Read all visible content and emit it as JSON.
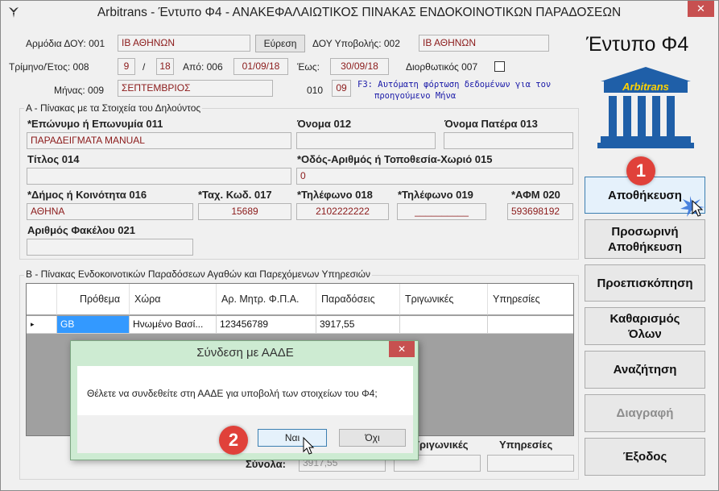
{
  "window": {
    "title": "Arbitrans - Έντυπο Φ4 - ΑΝΑΚΕΦΑΛΑΙΩΤΙΚΟΣ ΠΙΝΑΚΑΣ ΕΝΔΟΚΟΙΝΟΤΙΚΩΝ ΠΑΡΑΔΟΣΕΩΝ",
    "close_glyph": "✕"
  },
  "header": {
    "doy_label": "Αρμόδια ΔΟΥ: 001",
    "doy_value": "ΙΒ ΑΘΗΝΩΝ",
    "search_btn": "Εύρεση",
    "doy_submit_label": "ΔΟΥ Υποβολής: 002",
    "doy_submit_value": "ΙΒ ΑΘΗΝΩΝ",
    "quarter_label": "Τρίμηνο/Έτος: 008",
    "quarter_value": "9",
    "slash": "/",
    "year_value": "18",
    "from_label": "Από: 006",
    "from_value": "01/09/18",
    "to_label": "Έως:",
    "to_value": "30/09/18",
    "corrective_label": "Διορθωτικός 007",
    "month_label": "Μήνας: 009",
    "month_value": "ΣΕΠΤΕΜΒΡΙΟΣ",
    "code010_label": "010",
    "code010_value": "09",
    "hint_line1": "F3: Αυτόματη φόρτωση δεδομένων για τον",
    "hint_line2": "προηγούμενο Μήνα"
  },
  "form_title": "Έντυπο Φ4",
  "logo_text": "Arbitrans",
  "sectionA": {
    "title": "Α - Πίνακας με τα Στοιχεία του Δηλούντος",
    "name_label": "*Επώνυμο ή Επωνυμία 011",
    "name_value": "ΠΑΡΑΔΕΙΓΜΑΤΑ MANUAL",
    "first_name_label": "Όνομα 012",
    "first_name_value": "",
    "father_label": "Όνομα Πατέρα 013",
    "father_value": "",
    "title_label": "Τίτλος 014",
    "title_value": "",
    "street_label": "*Οδός-Αριθμός ή Τοποθεσία-Χωριό 015",
    "street_value": "0",
    "city_label": "*Δήμος ή Κοινότητα 016",
    "city_value": "ΑΘΗΝΑ",
    "zip_label": "*Ταχ. Κωδ. 017",
    "zip_value": "15689",
    "phone_label": "*Τηλέφωνο 018",
    "phone_value": "2102222222",
    "phone2_label": "*Τηλέφωνο 019",
    "phone2_value": "__________",
    "afm_label": "*ΑΦΜ 020",
    "afm_value": "593698192",
    "folder_label": "Αριθμός Φακέλου 021",
    "folder_value": ""
  },
  "sectionB": {
    "title": "Β - Πίνακας Ενδοκοινοτικών Παραδόσεων Αγαθών και Παρεχόμενων Υπηρεσιών",
    "columns": [
      "Πρόθεμα",
      "Χώρα",
      "Αρ. Μητρ. Φ.Π.Α.",
      "Παραδόσεις",
      "Τριγωνικές",
      "Υπηρεσίες"
    ],
    "rows": [
      {
        "indicator": "▸",
        "prefix": "GB",
        "country": "Ηνωμένο Βασί...",
        "vat": "123456789",
        "deliveries": "3917,55",
        "triangular": "",
        "services": ""
      }
    ],
    "totals_label": "Σύνολα:",
    "totals_deliveries": "3917,55",
    "totals_triangular_label": "Τριγωνικές",
    "totals_services_label": "Υπηρεσίες"
  },
  "side_buttons": {
    "save": "Αποθήκευση",
    "temp_save_line1": "Προσωρινή",
    "temp_save_line2": "Αποθήκευση",
    "preview": "Προεπισκόπηση",
    "clear_line1": "Καθαρισμός",
    "clear_line2": "Όλων",
    "search": "Αναζήτηση",
    "delete": "Διαγραφή",
    "exit": "Έξοδος"
  },
  "dialog": {
    "title": "Σύνδεση με ΑΑΔΕ",
    "message": "Θέλετε να συνδεθείτε στη ΑΑΔΕ για υποβολή των στοιχείων του Φ4;",
    "yes": "Ναι",
    "no": "Όχι",
    "close_glyph": "✕"
  },
  "markers": {
    "one": "1",
    "two": "2"
  },
  "colors": {
    "accent_red": "#e0413a",
    "value_text": "#8b1a1a",
    "dialog_bg": "#cdebd2",
    "selected_cell": "#3399ff",
    "logo_blue": "#1f5fa8"
  }
}
